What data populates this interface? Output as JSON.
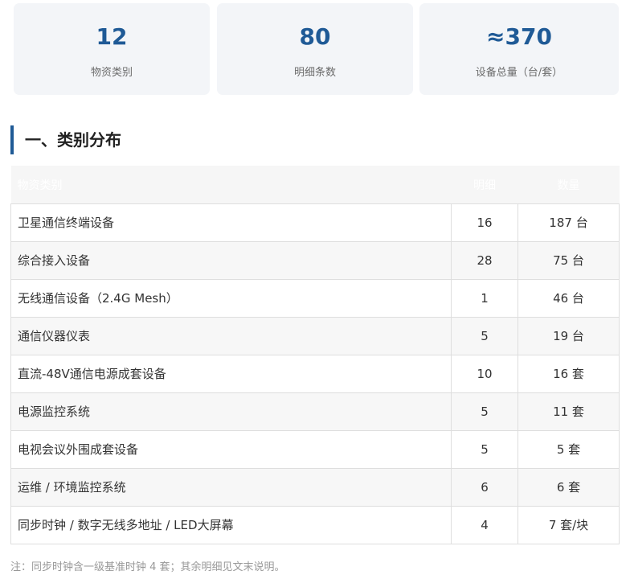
{
  "stats": [
    {
      "value": "12",
      "label": "物资类别"
    },
    {
      "value": "80",
      "label": "明细条数"
    },
    {
      "value": "≈370",
      "label": "设备总量（台/套）"
    }
  ],
  "section": {
    "title": "一、类别分布"
  },
  "table": {
    "headers": [
      "物资类别",
      "明细",
      "数量"
    ],
    "rows": [
      {
        "name": "卫星通信终端设备",
        "count": "16",
        "qty": "187 台"
      },
      {
        "name": "综合接入设备",
        "count": "28",
        "qty": "75 台"
      },
      {
        "name": "无线通信设备（2.4G Mesh）",
        "count": "1",
        "qty": "46 台"
      },
      {
        "name": "通信仪器仪表",
        "count": "5",
        "qty": "19 台"
      },
      {
        "name": "直流-48V通信电源成套设备",
        "count": "10",
        "qty": "16 套"
      },
      {
        "name": "电源监控系统",
        "count": "5",
        "qty": "11 套"
      },
      {
        "name": "电视会议外围成套设备",
        "count": "5",
        "qty": "5 套"
      },
      {
        "name": "运维 / 环境监控系统",
        "count": "6",
        "qty": "6 套"
      },
      {
        "name": "同步时钟 / 数字无线多地址 / LED大屏幕",
        "count": "4",
        "qty": "7 套/块"
      }
    ]
  },
  "note": "注：同步时钟含一级基准时钟 4 套；其余明细见文末说明。",
  "colors": {
    "accent": "#1f5a96",
    "card_bg": "#f3f5f8",
    "row_alt": "#f7f7f7",
    "border": "#dedede"
  }
}
